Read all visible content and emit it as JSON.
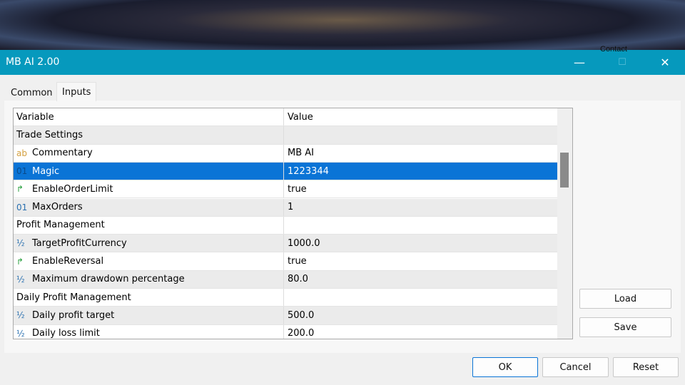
{
  "window": {
    "title": "MB AI 2.00",
    "overlay_text": "Contact",
    "minimize": "—",
    "maximize": "☐",
    "close": "✕"
  },
  "tabs": [
    {
      "label": "Common"
    },
    {
      "label": "Inputs",
      "active": true
    }
  ],
  "table": {
    "headers": [
      "Variable",
      "Value"
    ],
    "rows": [
      {
        "icon": "",
        "variable": "Trade Settings",
        "value": ""
      },
      {
        "icon": "ab",
        "variable": "Commentary",
        "value": "MB AI"
      },
      {
        "icon": "01",
        "variable": "Magic",
        "value": "1223344",
        "selected": true
      },
      {
        "icon": "↱",
        "variable": "EnableOrderLimit",
        "value": "true"
      },
      {
        "icon": "01",
        "variable": "MaxOrders",
        "value": "1"
      },
      {
        "icon": "",
        "variable": "Profit Management",
        "value": ""
      },
      {
        "icon": "½",
        "variable": "TargetProfitCurrency",
        "value": "1000.0"
      },
      {
        "icon": "↱",
        "variable": "EnableReversal",
        "value": "true"
      },
      {
        "icon": "½",
        "variable": "Maximum drawdown percentage",
        "value": "80.0"
      },
      {
        "icon": "",
        "variable": "Daily Profit Management",
        "value": ""
      },
      {
        "icon": "½",
        "variable": "Daily profit target",
        "value": "500.0"
      },
      {
        "icon": "½",
        "variable": "Daily loss limit",
        "value": "200.0"
      }
    ]
  },
  "buttons": {
    "load": "Load",
    "save": "Save",
    "ok": "OK",
    "cancel": "Cancel",
    "reset": "Reset"
  },
  "colors": {
    "titlebar": "#0699bd",
    "selection": "#0a74d6"
  }
}
